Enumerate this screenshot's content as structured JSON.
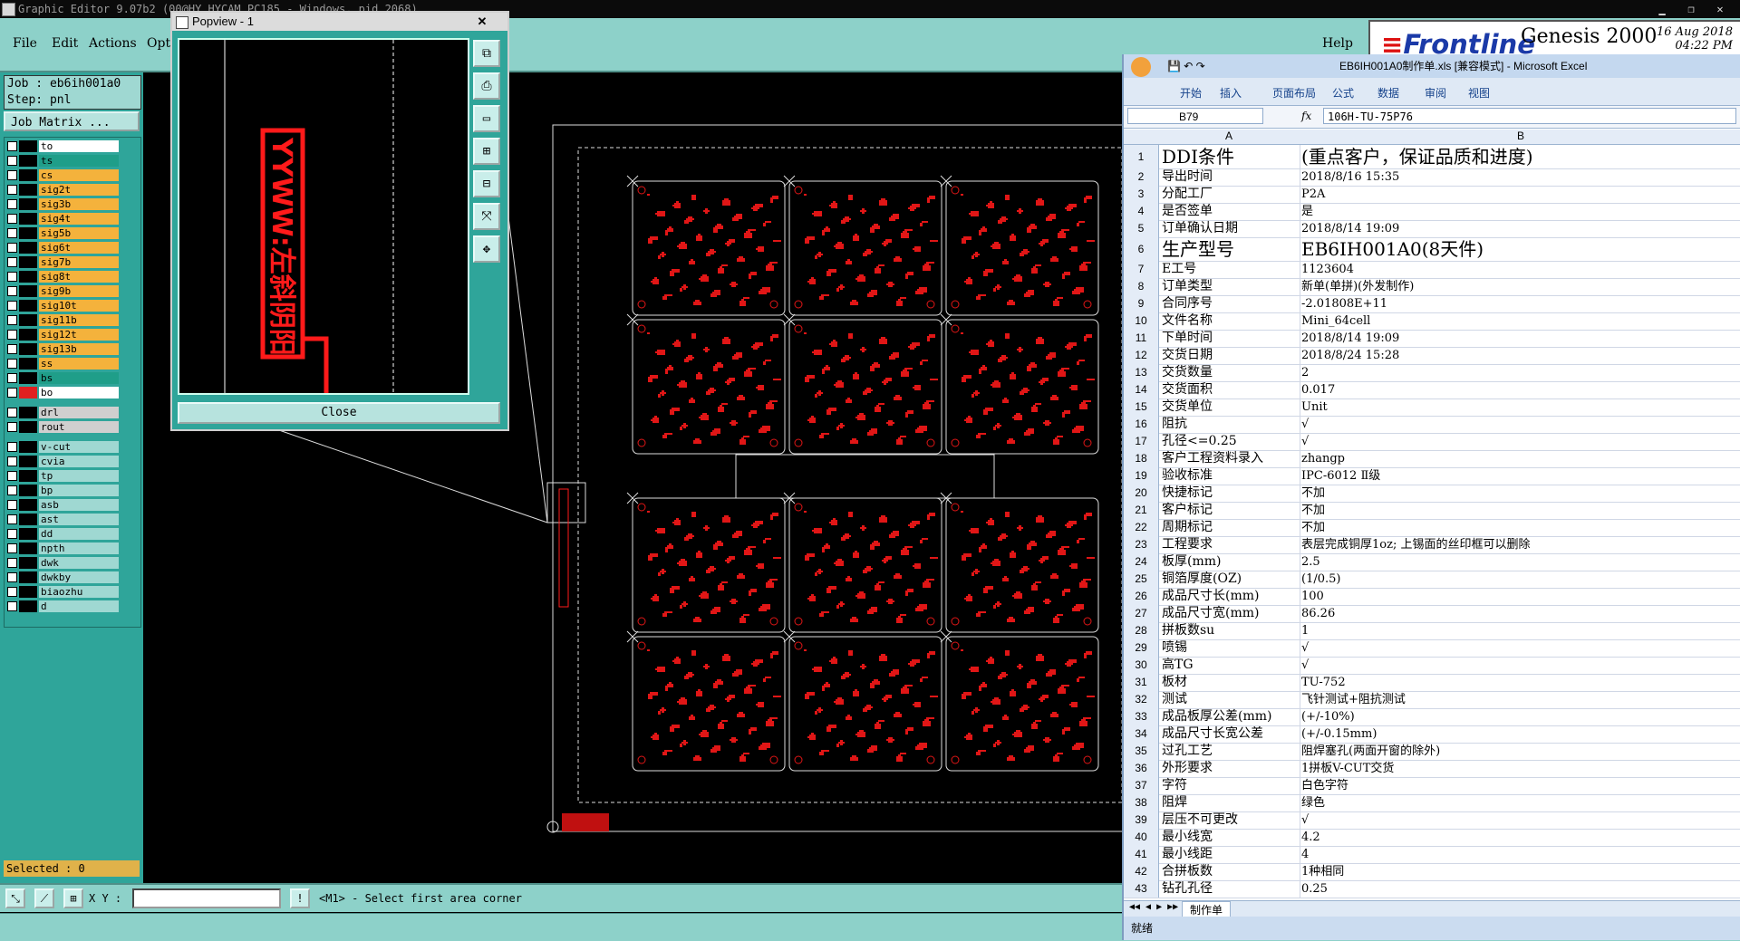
{
  "genesis": {
    "window_title": "Graphic Editor 9.07b2 (00@HY_HYCAM_PC185 - Windows, pid 2068)",
    "menus": [
      "File",
      "Edit",
      "Actions",
      "Opt"
    ],
    "help_label": "Help",
    "brand_logo": "Frontline",
    "brand_product": "Genesis 2000",
    "date": "16 Aug 2018",
    "time": "04:22 PM",
    "job_label": "Job : eb6ih001a0",
    "step_label": "Step: pnl",
    "job_matrix_button": "Job Matrix ...",
    "layers": [
      {
        "name": "to",
        "color": "#ffffff",
        "dot": "#000000"
      },
      {
        "name": "ts",
        "color": "#1f9e89",
        "dot": "#000000"
      },
      {
        "name": "cs",
        "color": "#f4b23c",
        "dot": "#000000"
      },
      {
        "name": "sig2t",
        "color": "#f4b23c",
        "dot": "#000000"
      },
      {
        "name": "sig3b",
        "color": "#f4b23c",
        "dot": "#000000"
      },
      {
        "name": "sig4t",
        "color": "#f4b23c",
        "dot": "#000000"
      },
      {
        "name": "sig5b",
        "color": "#f4b23c",
        "dot": "#000000"
      },
      {
        "name": "sig6t",
        "color": "#f4b23c",
        "dot": "#000000"
      },
      {
        "name": "sig7b",
        "color": "#f4b23c",
        "dot": "#000000"
      },
      {
        "name": "sig8t",
        "color": "#f4b23c",
        "dot": "#000000"
      },
      {
        "name": "sig9b",
        "color": "#f4b23c",
        "dot": "#000000"
      },
      {
        "name": "sig10t",
        "color": "#f4b23c",
        "dot": "#000000"
      },
      {
        "name": "sig11b",
        "color": "#f4b23c",
        "dot": "#000000"
      },
      {
        "name": "sig12t",
        "color": "#f4b23c",
        "dot": "#000000"
      },
      {
        "name": "sig13b",
        "color": "#f4b23c",
        "dot": "#000000"
      },
      {
        "name": "ss",
        "color": "#f4b23c",
        "dot": "#000000"
      },
      {
        "name": "bs",
        "color": "#1f9e89",
        "dot": "#000000"
      },
      {
        "name": "bo",
        "color": "#ffffff",
        "dot": "#e02020"
      },
      {
        "name": "drl",
        "color": "#cfcfcf",
        "dot": "#000000"
      },
      {
        "name": "rout",
        "color": "#cfcfcf",
        "dot": "#000000"
      },
      {
        "name": "v-cut",
        "color": "#9fd8d2",
        "dot": "#000000"
      },
      {
        "name": "cvia",
        "color": "#9fd8d2",
        "dot": "#000000"
      },
      {
        "name": "tp",
        "color": "#9fd8d2",
        "dot": "#000000"
      },
      {
        "name": "bp",
        "color": "#9fd8d2",
        "dot": "#000000"
      },
      {
        "name": "asb",
        "color": "#9fd8d2",
        "dot": "#000000"
      },
      {
        "name": "ast",
        "color": "#9fd8d2",
        "dot": "#000000"
      },
      {
        "name": "dd",
        "color": "#9fd8d2",
        "dot": "#000000"
      },
      {
        "name": "npth",
        "color": "#9fd8d2",
        "dot": "#000000"
      },
      {
        "name": "dwk",
        "color": "#9fd8d2",
        "dot": "#000000"
      },
      {
        "name": "dwkby",
        "color": "#9fd8d2",
        "dot": "#000000"
      },
      {
        "name": "biaozhu",
        "color": "#9fd8d2",
        "dot": "#000000"
      },
      {
        "name": "d",
        "color": "#9fd8d2",
        "dot": "#000000"
      }
    ],
    "selected_label": "Selected : 0",
    "xy_label": "X Y :",
    "prompt": "<M1> - Select first area corner",
    "popview_title": "Popview - 1",
    "popview_text": "YYWW:左斜阴阳",
    "popview_close": "Close",
    "accent_color": "#8dd1c9"
  },
  "excel": {
    "title": "EB6IH001A0制作单.xls [兼容模式] - Microsoft Excel",
    "ribbon_tabs": [
      "开始",
      "插入",
      "页面布局",
      "公式",
      "数据",
      "审阅",
      "视图"
    ],
    "name_box": "B79",
    "formula": "106H-TU-75P76",
    "col_a": "A",
    "col_b": "B",
    "rows": [
      {
        "n": "1",
        "a": "DDI条件",
        "b": "(重点客户，保证品质和进度)",
        "big": true
      },
      {
        "n": "2",
        "a": "导出时间",
        "b": "2018/8/16 15:35"
      },
      {
        "n": "3",
        "a": "分配工厂",
        "b": "P2A"
      },
      {
        "n": "4",
        "a": "是否签单",
        "b": "是"
      },
      {
        "n": "5",
        "a": "订单确认日期",
        "b": "2018/8/14 19:09"
      },
      {
        "n": "6",
        "a": "生产型号",
        "b": "EB6IH001A0(8天件)",
        "big": true
      },
      {
        "n": "7",
        "a": "E工号",
        "b": "1123604"
      },
      {
        "n": "8",
        "a": "订单类型",
        "b": "新单(单拼)(外发制作)"
      },
      {
        "n": "9",
        "a": "合同序号",
        "b": "-2.01808E+11"
      },
      {
        "n": "10",
        "a": "文件名称",
        "b": "Mini_64cell"
      },
      {
        "n": "11",
        "a": "下单时间",
        "b": "2018/8/14 19:09"
      },
      {
        "n": "12",
        "a": "交货日期",
        "b": "2018/8/24 15:28"
      },
      {
        "n": "13",
        "a": "交货数量",
        "b": "2"
      },
      {
        "n": "14",
        "a": "交货面积",
        "b": "0.017"
      },
      {
        "n": "15",
        "a": "交货单位",
        "b": "Unit"
      },
      {
        "n": "16",
        "a": "阻抗",
        "b": "√"
      },
      {
        "n": "17",
        "a": "孔径<=0.25",
        "b": "√"
      },
      {
        "n": "18",
        "a": "客户工程资料录入",
        "b": "zhangp"
      },
      {
        "n": "19",
        "a": "验收标准",
        "b": "IPC-6012 Ⅱ级"
      },
      {
        "n": "20",
        "a": "快捷标记",
        "b": "不加"
      },
      {
        "n": "21",
        "a": "客户标记",
        "b": "不加"
      },
      {
        "n": "22",
        "a": "周期标记",
        "b": "不加"
      },
      {
        "n": "23",
        "a": "工程要求",
        "b": "表层完成铜厚1oz; 上锡面的丝印框可以删除"
      },
      {
        "n": "24",
        "a": "板厚(mm)",
        "b": "2.5"
      },
      {
        "n": "25",
        "a": "铜箔厚度(OZ)",
        "b": "(1/0.5)"
      },
      {
        "n": "26",
        "a": "成品尺寸长(mm)",
        "b": "100"
      },
      {
        "n": "27",
        "a": "成品尺寸宽(mm)",
        "b": "86.26"
      },
      {
        "n": "28",
        "a": "拼板数su",
        "b": "1"
      },
      {
        "n": "29",
        "a": "喷锡",
        "b": "√"
      },
      {
        "n": "30",
        "a": "高TG",
        "b": "√"
      },
      {
        "n": "31",
        "a": "板材",
        "b": "TU-752"
      },
      {
        "n": "32",
        "a": "测试",
        "b": "飞针测试+阻抗测试"
      },
      {
        "n": "33",
        "a": "成品板厚公差(mm)",
        "b": "(+/-10%)"
      },
      {
        "n": "34",
        "a": "成品尺寸长宽公差",
        "b": "(+/-0.15mm)"
      },
      {
        "n": "35",
        "a": "过孔工艺",
        "b": "阻焊塞孔(两面开窗的除外)"
      },
      {
        "n": "36",
        "a": "外形要求",
        "b": "1拼板V-CUT交货"
      },
      {
        "n": "37",
        "a": "字符",
        "b": "白色字符"
      },
      {
        "n": "38",
        "a": "阻焊",
        "b": "绿色"
      },
      {
        "n": "39",
        "a": "层压不可更改",
        "b": "√"
      },
      {
        "n": "40",
        "a": "最小线宽",
        "b": "4.2"
      },
      {
        "n": "41",
        "a": "最小线距",
        "b": "4"
      },
      {
        "n": "42",
        "a": "合拼板数",
        "b": "1种相同"
      },
      {
        "n": "43",
        "a": "钻孔孔径",
        "b": "0.25"
      }
    ],
    "sheet_tab": "制作单",
    "status": "就绪"
  }
}
